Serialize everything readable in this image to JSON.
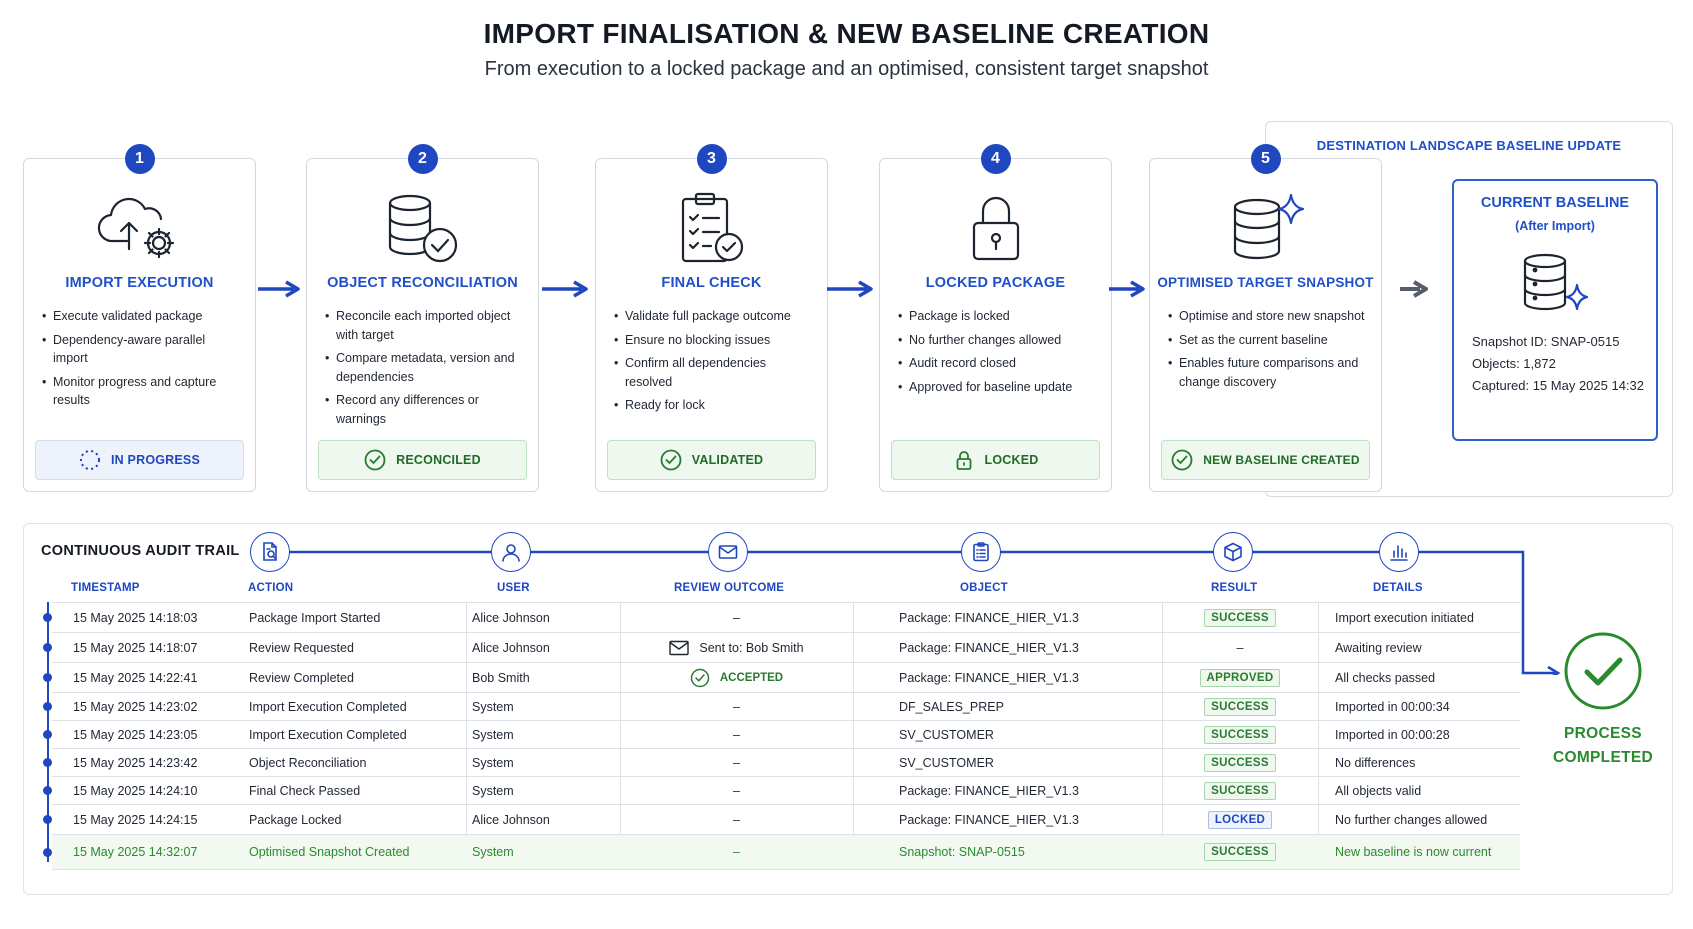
{
  "header": {
    "title": "IMPORT FINALISATION & NEW BASELINE CREATION",
    "subtitle": "From execution to a locked package and an optimised, consistent target snapshot"
  },
  "destination": {
    "title": "DESTINATION LANDSCAPE BASELINE UPDATE",
    "baseline_title": "CURRENT BASELINE",
    "baseline_subtitle": "(After Import)",
    "snapshot_id": "Snapshot ID: SNAP-0515",
    "objects": "Objects: 1,872",
    "captured": "Captured: 15 May 2025 14:32"
  },
  "steps": [
    {
      "num": "1",
      "title": "IMPORT EXECUTION",
      "icon": "cloud-upload-gear-icon",
      "bullets": [
        "Execute validated package",
        "Dependency-aware parallel import",
        "Monitor progress and capture results"
      ],
      "status": "IN PROGRESS",
      "status_icon": "spinner-icon"
    },
    {
      "num": "2",
      "title": "OBJECT RECONCILIATION",
      "icon": "database-check-icon",
      "bullets": [
        "Reconcile each imported object with target",
        "Compare metadata, version and dependencies",
        "Record any differences or warnings"
      ],
      "status": "RECONCILED",
      "status_icon": "check-circle-icon"
    },
    {
      "num": "3",
      "title": "FINAL CHECK",
      "icon": "clipboard-check-icon",
      "bullets": [
        "Validate full package outcome",
        "Ensure no blocking issues",
        "Confirm all dependencies resolved",
        "Ready for lock"
      ],
      "status": "VALIDATED",
      "status_icon": "check-circle-icon"
    },
    {
      "num": "4",
      "title": "LOCKED PACKAGE",
      "icon": "padlock-icon",
      "bullets": [
        "Package is locked",
        "No further changes allowed",
        "Audit record closed",
        "Approved for baseline update"
      ],
      "status": "LOCKED",
      "status_icon": "lock-icon"
    },
    {
      "num": "5",
      "title": "OPTIMISED TARGET SNAPSHOT",
      "icon": "database-sparkle-icon",
      "bullets": [
        "Optimise and store new snapshot",
        "Set as the current baseline",
        "Enables future comparisons and change discovery"
      ],
      "status": "NEW BASELINE CREATED",
      "status_icon": "check-circle-icon"
    }
  ],
  "audit": {
    "title": "CONTINUOUS AUDIT TRAIL",
    "columns": [
      {
        "label": "TIMESTAMP",
        "icon": ""
      },
      {
        "label": "ACTION",
        "icon": "document-search-icon"
      },
      {
        "label": "USER",
        "icon": "user-icon"
      },
      {
        "label": "REVIEW OUTCOME",
        "icon": "envelope-icon"
      },
      {
        "label": "OBJECT",
        "icon": "clipboard-list-icon"
      },
      {
        "label": "RESULT",
        "icon": "cube-icon"
      },
      {
        "label": "DETAILS",
        "icon": "bar-chart-icon"
      }
    ],
    "rows": [
      {
        "timestamp": "15 May 2025 14:18:03",
        "action": "Package Import Started",
        "user": "Alice Johnson",
        "review": "–",
        "review_icon": "",
        "object": "Package: FINANCE_HIER_V1.3",
        "result": "SUCCESS",
        "result_kind": "success",
        "details": "Import execution initiated"
      },
      {
        "timestamp": "15 May 2025 14:18:07",
        "action": "Review Requested",
        "user": "Alice Johnson",
        "review": "Sent to: Bob Smith",
        "review_icon": "envelope-icon",
        "object": "Package: FINANCE_HIER_V1.3",
        "result": "–",
        "result_kind": "none",
        "details": "Awaiting review"
      },
      {
        "timestamp": "15 May 2025 14:22:41",
        "action": "Review Completed",
        "user": "Bob Smith",
        "review": "ACCEPTED",
        "review_icon": "check-circle-icon",
        "object": "Package: FINANCE_HIER_V1.3",
        "result": "APPROVED",
        "result_kind": "success",
        "details": "All checks passed"
      },
      {
        "timestamp": "15 May 2025 14:23:02",
        "action": "Import Execution Completed",
        "user": "System",
        "review": "–",
        "review_icon": "",
        "object": "DF_SALES_PREP",
        "result": "SUCCESS",
        "result_kind": "success",
        "details": "Imported in 00:00:34"
      },
      {
        "timestamp": "15 May 2025 14:23:05",
        "action": "Import Execution Completed",
        "user": "System",
        "review": "–",
        "review_icon": "",
        "object": "SV_CUSTOMER",
        "result": "SUCCESS",
        "result_kind": "success",
        "details": "Imported in 00:00:28"
      },
      {
        "timestamp": "15 May 2025 14:23:42",
        "action": "Object Reconciliation",
        "user": "System",
        "review": "–",
        "review_icon": "",
        "object": "SV_CUSTOMER",
        "result": "SUCCESS",
        "result_kind": "success",
        "details": "No differences"
      },
      {
        "timestamp": "15 May 2025 14:24:10",
        "action": "Final Check Passed",
        "user": "System",
        "review": "–",
        "review_icon": "",
        "object": "Package: FINANCE_HIER_V1.3",
        "result": "SUCCESS",
        "result_kind": "success",
        "details": "All objects valid"
      },
      {
        "timestamp": "15 May 2025 14:24:15",
        "action": "Package Locked",
        "user": "Alice Johnson",
        "review": "–",
        "review_icon": "",
        "object": "Package: FINANCE_HIER_V1.3",
        "result": "LOCKED",
        "result_kind": "locked",
        "details": "No further changes allowed"
      },
      {
        "timestamp": "15 May 2025 14:32:07",
        "action": "Optimised Snapshot Created",
        "user": "System",
        "review": "–",
        "review_icon": "",
        "object": "Snapshot: SNAP-0515",
        "result": "SUCCESS",
        "result_kind": "success",
        "details": "New baseline is now current"
      }
    ]
  },
  "completion": {
    "line1": "PROCESS",
    "line2": "COMPLETED"
  },
  "colors": {
    "accent": "#1f47c0",
    "title_blue": "#1f4fc9",
    "success_green": "#2a8a2e",
    "border": "#d3d8df"
  }
}
